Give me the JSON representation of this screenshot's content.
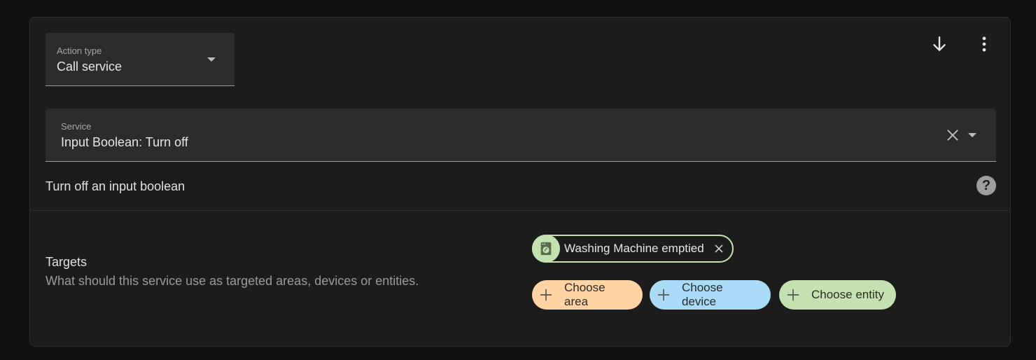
{
  "action_type": {
    "label": "Action type",
    "value": "Call service"
  },
  "header_actions": {
    "move_down_icon": "arrow-down-icon",
    "menu_icon": "dots-vertical-icon"
  },
  "service": {
    "label": "Service",
    "value": "Input Boolean: Turn off",
    "clear_icon": "close-icon",
    "expand_icon": "chevron-down-icon"
  },
  "description": "Turn off an input boolean",
  "help_icon": "help-circle-icon",
  "targets": {
    "title": "Targets",
    "description": "What should this service use as targeted areas, devices or entities.",
    "selected_entity": {
      "label": "Washing Machine emptied",
      "icon": "washing-machine-icon",
      "color": "#c5e1b0"
    },
    "add_buttons": [
      {
        "label": "Choose area",
        "color": "#ffd3a3"
      },
      {
        "label": "Choose device",
        "color": "#a9dbf7"
      },
      {
        "label": "Choose entity",
        "color": "#c5e1b0"
      }
    ]
  }
}
